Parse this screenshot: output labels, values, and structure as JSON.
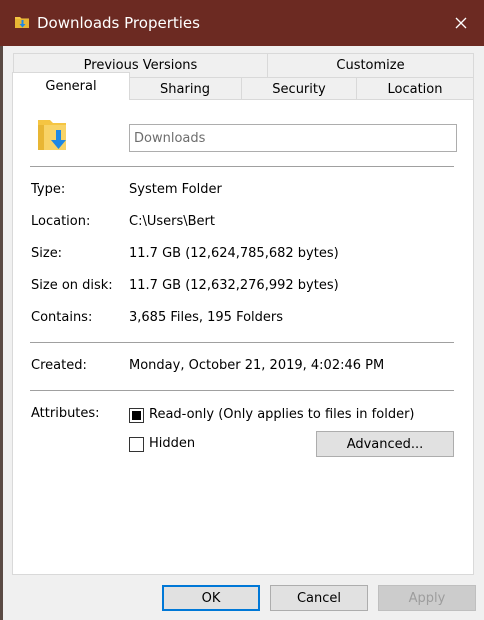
{
  "window": {
    "title": "Downloads Properties",
    "icons": {
      "title": "folder-download-icon",
      "close": "close-icon"
    }
  },
  "tabs": {
    "row1": [
      "Previous Versions",
      "Customize"
    ],
    "row2": [
      "General",
      "Sharing",
      "Security",
      "Location"
    ],
    "active": "General"
  },
  "general": {
    "folder_icon": "folder-download-icon",
    "name_value": "Downloads",
    "type_label": "Type:",
    "type_value": "System Folder",
    "location_label": "Location:",
    "location_value": "C:\\Users\\Bert",
    "size_label": "Size:",
    "size_value": "11.7 GB (12,624,785,682 bytes)",
    "size_on_disk_label": "Size on disk:",
    "size_on_disk_value": "11.7 GB (12,632,276,992 bytes)",
    "contains_label": "Contains:",
    "contains_value": "3,685 Files, 195 Folders",
    "created_label": "Created:",
    "created_value": "Monday, October 21, 2019, 4:02:46 PM",
    "attributes_label": "Attributes:",
    "readonly_label": "Read-only (Only applies to files in folder)",
    "readonly_state": "indeterminate",
    "hidden_label": "Hidden",
    "hidden_state": "unchecked",
    "advanced_label": "Advanced..."
  },
  "footer": {
    "ok_label": "OK",
    "cancel_label": "Cancel",
    "apply_label": "Apply"
  },
  "colors": {
    "titlebar": "#6c2a22",
    "focus_border": "#0078d7",
    "folder": "#f5c542",
    "arrow": "#1e88e5"
  }
}
